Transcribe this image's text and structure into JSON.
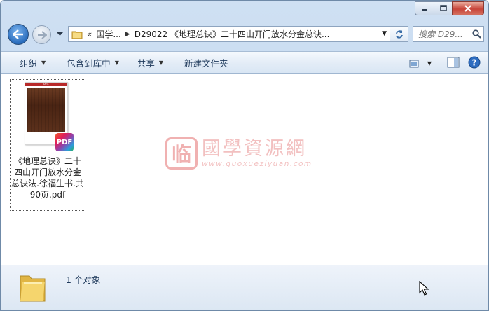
{
  "window": {
    "caption": {
      "minimize": "minimize",
      "maximize": "maximize",
      "close": "close"
    }
  },
  "nav": {
    "breadcrumb": [
      "«",
      "国学...",
      "D29022 《地理总诀》二十四山开门放水分金总诀..."
    ],
    "search_placeholder": "搜索 D29..."
  },
  "commands": {
    "organize": "组织",
    "include_in_library": "包含到库中",
    "share": "共享",
    "new_folder": "新建文件夹"
  },
  "file": {
    "name": "《地理总诀》二十四山开门放水分金总诀法.徐福生书.共90页.pdf",
    "badge": "PDF",
    "thumb_bar": "PDF"
  },
  "watermark": {
    "seal": "临",
    "title": "國學資源網",
    "url": "www.guoxueziyuan.com"
  },
  "details": {
    "count": "1 个对象"
  },
  "colors": {
    "accent": "#2a6dbd",
    "close_button": "#c8453a",
    "watermark": "#e57373"
  }
}
